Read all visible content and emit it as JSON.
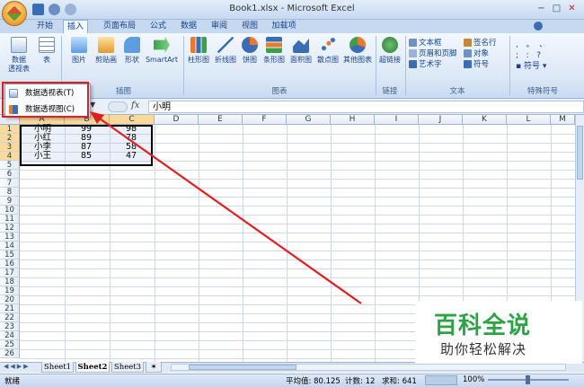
{
  "window": {
    "title": "Book1.xlsx - Microsoft Excel",
    "minimize": "−",
    "maximize": "□",
    "close": "✕"
  },
  "tabs": [
    "开始",
    "插入",
    "页面布局",
    "公式",
    "数据",
    "审阅",
    "视图",
    "加载项"
  ],
  "active_tab": "插入",
  "ribbon": {
    "table_group": {
      "pivot_label": "数据\n透视表",
      "table_label": "表"
    },
    "illustrations": {
      "label": "插图",
      "buttons": [
        "图片",
        "剪贴画",
        "形状",
        "SmartArt"
      ]
    },
    "charts": {
      "label": "图表",
      "buttons": [
        "柱形图",
        "折线图",
        "饼图",
        "条形图",
        "面积图",
        "散点图",
        "其他图表"
      ]
    },
    "links": {
      "label": "链接",
      "buttons": [
        "超链接"
      ]
    },
    "text": {
      "label": "文本",
      "items": [
        "文本框",
        "页眉和页脚",
        "艺术字",
        "签名行",
        "对象",
        "符号"
      ]
    },
    "special_symbols": {
      "label": "特殊符号",
      "items": [
        "符号"
      ]
    }
  },
  "pivot_menu": {
    "items": [
      "数据透视表(T)",
      "数据透视图(C)"
    ]
  },
  "formula_bar": {
    "fx": "fx",
    "value": "小明"
  },
  "columns": [
    "A",
    "B",
    "C",
    "D",
    "E",
    "F",
    "G",
    "H",
    "I",
    "J",
    "K",
    "L",
    "M"
  ],
  "rows": [
    "1",
    "2",
    "3",
    "4",
    "5",
    "6",
    "7",
    "8",
    "9",
    "10",
    "11",
    "12",
    "13",
    "14",
    "15",
    "16",
    "17",
    "18",
    "19",
    "20",
    "21",
    "22",
    "23",
    "24",
    "25",
    "26"
  ],
  "cells": [
    [
      "小明",
      "99",
      "98"
    ],
    [
      "小红",
      "89",
      "78"
    ],
    [
      "小李",
      "87",
      "58"
    ],
    [
      "小王",
      "85",
      "47"
    ]
  ],
  "sheets": [
    "Sheet1",
    "Sheet2",
    "Sheet3"
  ],
  "active_sheet": "Sheet2",
  "status": {
    "ready": "就绪",
    "average": "平均值: 80.125",
    "count": "计数: 12",
    "sum": "求和: 641",
    "zoom": "100%"
  },
  "watermark": {
    "title": "百科全说",
    "subtitle": "助你轻松解决"
  },
  "colors": {
    "accent_red": "#e02020",
    "watermark_green": "#2da444"
  }
}
